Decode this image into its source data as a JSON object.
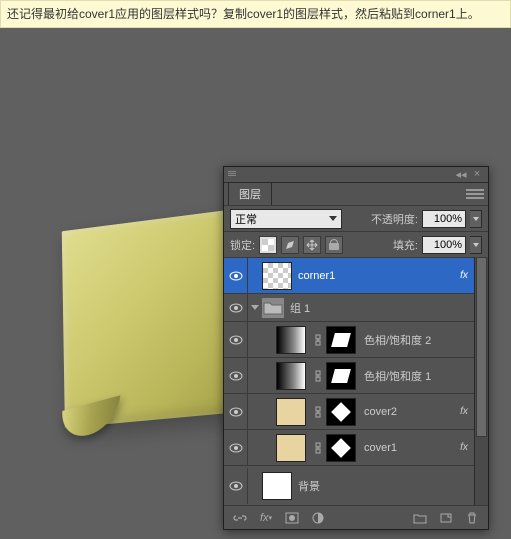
{
  "banner": "还记得最初给cover1应用的图层样式吗？复制cover1的图层样式，然后粘贴到corner1上。",
  "panel": {
    "tab": "图层",
    "blend_mode": "正常",
    "opacity_label": "不透明度:",
    "opacity_value": "100%",
    "lock_label": "锁定:",
    "fill_label": "填充:",
    "fill_value": "100%"
  },
  "layers": [
    {
      "name": "corner1",
      "selected": true,
      "thumb": "checker",
      "fx": true
    },
    {
      "name": "组 1",
      "type": "group"
    },
    {
      "name": "色相/饱和度 2",
      "thumb": "grad",
      "mask": "para",
      "indent": 2
    },
    {
      "name": "色相/饱和度 1",
      "thumb": "grad",
      "mask": "para",
      "indent": 2
    },
    {
      "name": "cover2",
      "thumb": "beige",
      "mask": "diamond",
      "indent": 2,
      "fx": true
    },
    {
      "name": "cover1",
      "thumb": "beige",
      "mask": "diamond",
      "indent": 2,
      "fx": true
    },
    {
      "name": "背景",
      "thumb": "white",
      "type": "bg"
    }
  ],
  "fx_label": "fx"
}
